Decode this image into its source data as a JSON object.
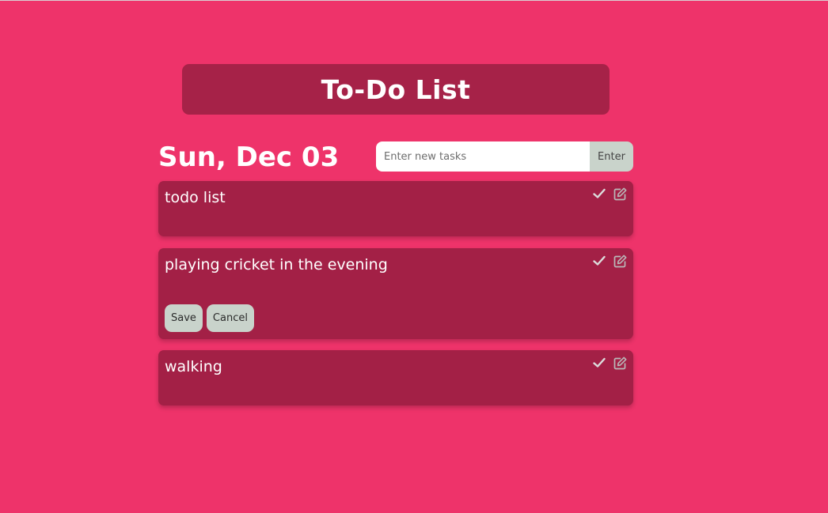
{
  "header": {
    "title": "To-Do List"
  },
  "date_label": "Sun, Dec 03",
  "new_task": {
    "placeholder": "Enter new tasks",
    "value": "",
    "submit_label": "Enter"
  },
  "tasks": [
    {
      "text": "todo list",
      "complete_icon": "check-icon",
      "edit_icon": "edit-icon"
    },
    {
      "text": "playing cricket in the evening",
      "complete_icon": "check-icon",
      "edit_icon": "edit-icon",
      "editing": true,
      "save_label": "Save",
      "cancel_label": "Cancel"
    },
    {
      "text": "walking",
      "complete_icon": "check-icon",
      "edit_icon": "edit-icon"
    }
  ],
  "colors": {
    "background": "#ee336a",
    "panel": "#a32046",
    "title_panel": "#a62248",
    "button": "#c9d3cb",
    "text": "#ffffff"
  }
}
